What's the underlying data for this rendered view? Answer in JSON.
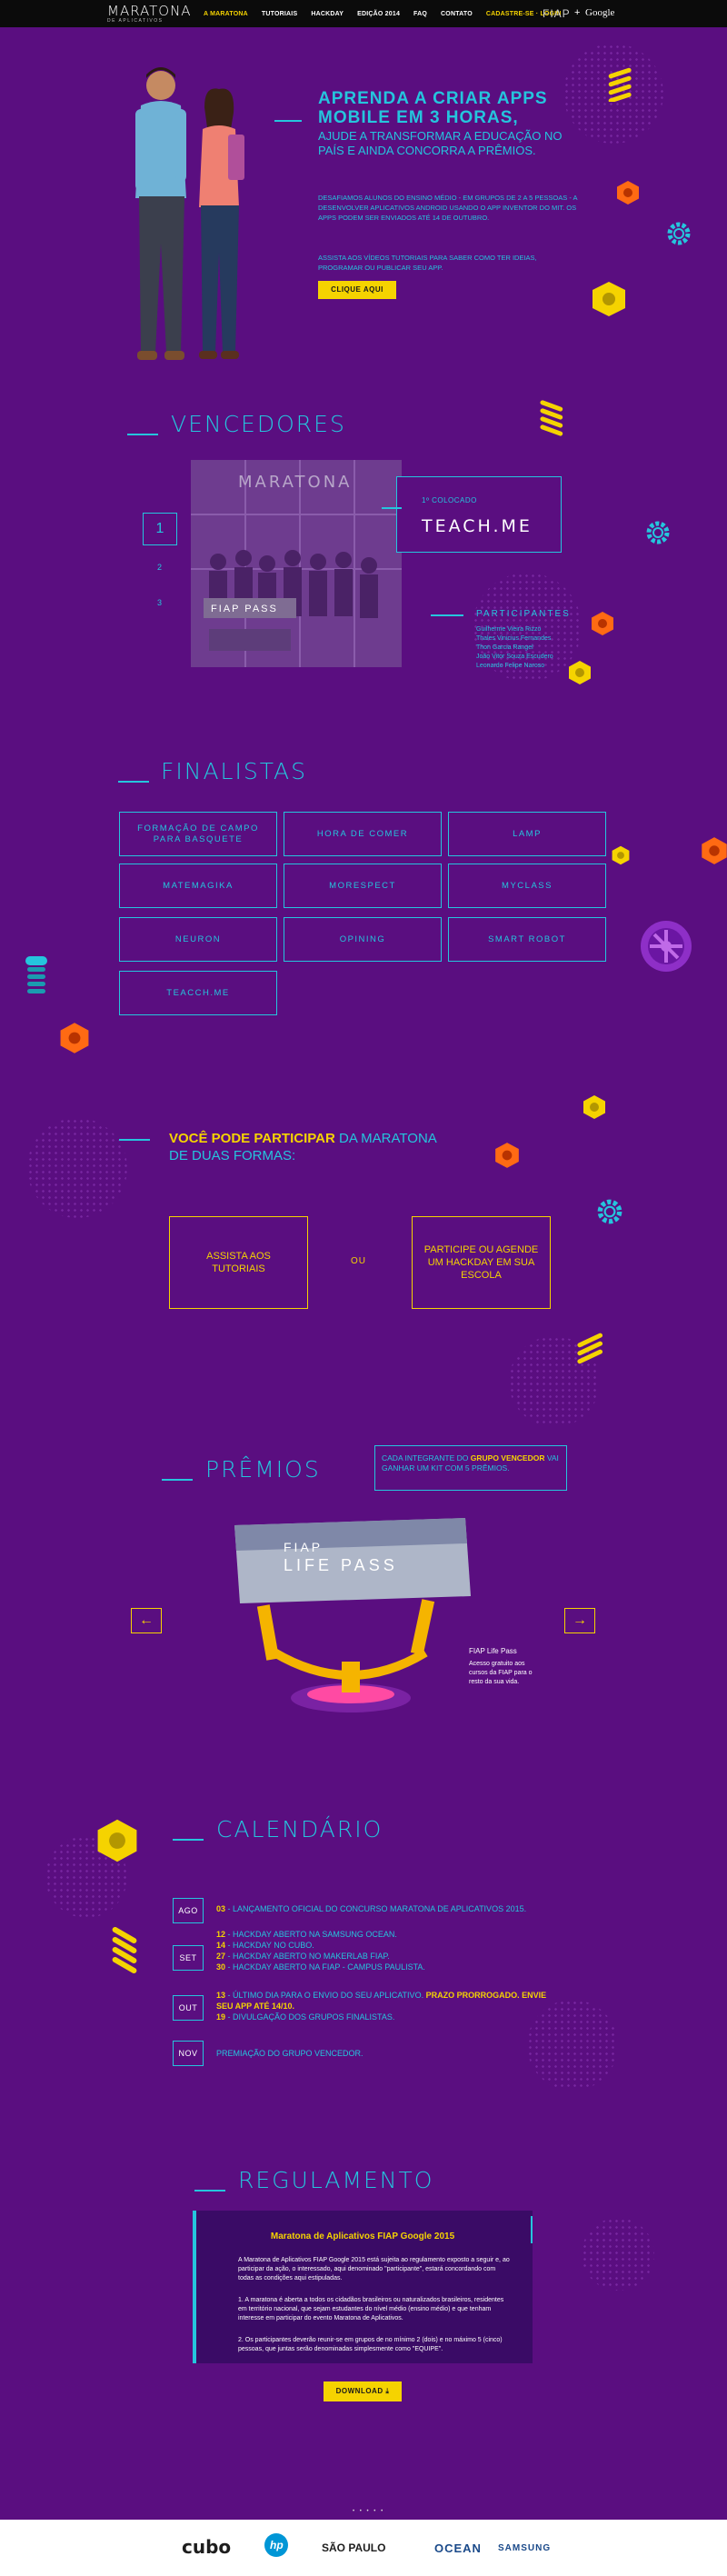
{
  "nav": {
    "logo": "MARATONA",
    "logo_sub": "DE APLICATIVOS",
    "items": [
      {
        "label": "A MARATONA",
        "active": true
      },
      {
        "label": "TUTORIAIS"
      },
      {
        "label": "HACKDAY"
      },
      {
        "label": "EDIÇÃO 2014"
      },
      {
        "label": "FAQ"
      },
      {
        "label": "CONTATO"
      },
      {
        "label": "CADASTRE-SE · LOGIN",
        "cta": true
      }
    ],
    "partner_fiap": "FIAP",
    "partner_plus": "+",
    "partner_google": "Google"
  },
  "hero": {
    "title": "APRENDA A CRIAR APPS MOBILE EM 3 HORAS,",
    "subtitle": "AJUDE A TRANSFORMAR A EDUCAÇÃO NO PAÍS E AINDA CONCORRA A PRÊMIOS.",
    "desc": "DESAFIAMOS ALUNOS DO ENSINO MÉDIO - EM GRUPOS DE 2 A 5 PESSOAS - A DESENVOLVER APLICATIVOS ANDROID USANDO O APP INVENTOR DO MIT. OS APPS PODEM SER ENVIADOS ATÉ 14 DE OUTUBRO.",
    "desc2": "ASSISTA AOS VÍDEOS TUTORIAIS PARA SABER COMO TER IDEIAS, PROGRAMAR OU PUBLICAR SEU APP.",
    "button": "CLIQUE AQUI"
  },
  "winners": {
    "title": "VENCEDORES",
    "photo_caption": "MARATONA",
    "photo_banner": "FIAP PASS",
    "nums": [
      "1",
      "2",
      "3"
    ],
    "place": "1º COLOCADO",
    "name": "TEACH.ME",
    "participants_title": "PARTICIPANTES",
    "participants": [
      "Guilherme Vieira Rizzo",
      "Thales Vinicius Fernandes",
      "Thon Garcia Rangel",
      "João Vitor Souza Escudero",
      "Leonardo Felipe Naroso"
    ]
  },
  "finalists": {
    "title": "FINALISTAS",
    "items": [
      "FORMAÇÃO DE CAMPO PARA BASQUETE",
      "HORA DE COMER",
      "LAMP",
      "MATEMAGIKA",
      "MORESPECT",
      "MYCLASS",
      "NEURON",
      "OPINING",
      "SMART ROBOT",
      "TEACCH.ME"
    ]
  },
  "participate": {
    "title_bold": "VOCÊ PODE PARTICIPAR",
    "title_rest": " DA MARATONA DE DUAS FORMAS:",
    "option1": "ASSISTA AOS TUTORIAIS",
    "or": "OU",
    "option2": "PARTICIPE OU AGENDE UM HACKDAY EM SUA ESCOLA"
  },
  "prizes": {
    "title": "PRÊMIOS",
    "card_pre": "CADA INTEGRANTE DO ",
    "card_bold": "GRUPO VENCEDOR",
    "card_post": " VAI GANHAR UM KIT COM 5 PRÊMIOS.",
    "prev": "←",
    "next": "→",
    "prize_brand": "FIAP",
    "prize_name": "LIFE PASS",
    "prize_caption_title": "FIAP Life Pass",
    "prize_caption": "Acesso gratuito aos cursos da FIAP para o resto da sua vida."
  },
  "calendar": {
    "title": "CALENDÁRIO",
    "rows": [
      {
        "month": "AGO",
        "lines": [
          {
            "b": "03",
            "t": " - LANÇAMENTO OFICIAL DO CONCURSO MARATONA DE APLICATIVOS 2015."
          }
        ]
      },
      {
        "month": "SET",
        "lines": [
          {
            "b": "12",
            "t": " - HACKDAY ABERTO NA SAMSUNG OCEAN."
          },
          {
            "b": "14",
            "t": " - HACKDAY NO CUBO."
          },
          {
            "b": "27",
            "t": " - HACKDAY ABERTO NO MAKERLAB FIAP."
          },
          {
            "b": "30",
            "t": " - HACKDAY ABERTO NA FIAP - CAMPUS PAULISTA."
          }
        ]
      },
      {
        "month": "OUT",
        "lines": [
          {
            "b": "13",
            "t": " - ÚLTIMO DIA PARA O ENVIO DO SEU APLICATIVO. ",
            "b2": "PRAZO PRORROGADO. ENVIE SEU APP ATÉ 14/10."
          },
          {
            "b": "19",
            "t": " - DIVULGAÇÃO DOS GRUPOS FINALISTAS."
          }
        ]
      },
      {
        "month": "NOV",
        "lines": [
          {
            "b": "",
            "t": "PREMIAÇÃO DO GRUPO VENCEDOR."
          }
        ]
      }
    ]
  },
  "rules": {
    "title": "REGULAMENTO",
    "doc_title": "Maratona de Aplicativos FIAP Google 2015",
    "p1": "A Maratona de Aplicativos FIAP Google 2015 está sujeita ao regulamento exposto a seguir e, ao participar da ação, o interessado, aqui denominado \"participante\", estará concordando com todas as condições aqui estipuladas.",
    "p2": "1. A maratona é aberta a todos os cidadãos brasileiros ou naturalizados brasileiros, residentes em território nacional, que sejam estudantes do nível médio (ensino médio) e que tenham interesse em participar do evento Maratona de Aplicativos.",
    "p3": "2. Os participantes deverão reunir-se em grupos de no mínimo 2 (dois) e no máximo 5 (cinco) pessoas, que juntas serão denominadas simplesmente como \"EQUIPE\".",
    "download": "DOWNLOAD ⤓"
  },
  "footer": {
    "pager": "• • • • •",
    "logos": [
      "cubo",
      "hp",
      "SÃO PAULO",
      "OCEAN",
      "SAMSUNG"
    ]
  },
  "colors": {
    "background": "#5a0e80",
    "accent_cyan": "#25c5dd",
    "accent_yellow": "#f5d300",
    "accent_orange": "#ff6a13"
  }
}
